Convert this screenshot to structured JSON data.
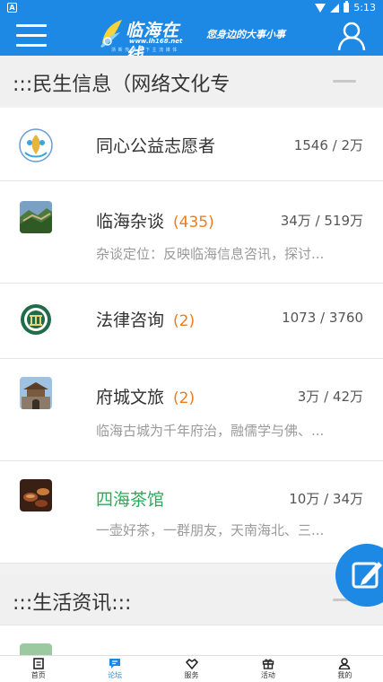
{
  "status_bar": {
    "notification_icon": "A",
    "time": "5:13"
  },
  "app_bar": {
    "logo_name": "临海在线",
    "logo_url": "www.lh168.net",
    "logo_sub": "浙 新 传 媒 旗 下 主 流 媒 体",
    "slogan": "您身边的大事小事",
    "menu_icon": "hamburger-icon",
    "user_icon": "user-icon"
  },
  "sections": [
    {
      "title": ":::民生信息（网络文化专",
      "items": [
        {
          "name": "同心公益志愿者",
          "count": "",
          "stats": "1546 / 2万",
          "desc": "",
          "icon": "volunteer-emblem-icon"
        },
        {
          "name": "临海杂谈",
          "count": "(435)",
          "stats": "34万 / 519万",
          "desc": "杂谈定位：反映临海信息咨讯，探讨...",
          "icon": "great-wall-photo-icon"
        },
        {
          "name": "法律咨询",
          "count": "(2)",
          "stats": "1073 / 3760",
          "desc": "",
          "icon": "court-emblem-icon"
        },
        {
          "name": "府城文旅",
          "count": "(2)",
          "stats": "3万 / 42万",
          "desc": "临海古城为千年府治，融儒学与佛、...",
          "icon": "city-gate-photo-icon"
        },
        {
          "name": "四海茶馆",
          "count": "",
          "stats": "10万 / 34万",
          "desc": "一壶好茶，一群朋友，天南海北、三...",
          "icon": "tea-photo-icon"
        }
      ]
    },
    {
      "title": ":::生活资讯:::"
    }
  ],
  "tabs": [
    {
      "label": "首页",
      "icon": "home-icon"
    },
    {
      "label": "论坛",
      "icon": "forum-icon"
    },
    {
      "label": "服务",
      "icon": "service-icon"
    },
    {
      "label": "活动",
      "icon": "gift-icon"
    },
    {
      "label": "我的",
      "icon": "profile-icon"
    }
  ],
  "active_tab": "论坛",
  "colors": {
    "brand_blue": "#1e88e5",
    "count_orange": "#ef7b19",
    "highlight_green": "#2eaa5a"
  }
}
